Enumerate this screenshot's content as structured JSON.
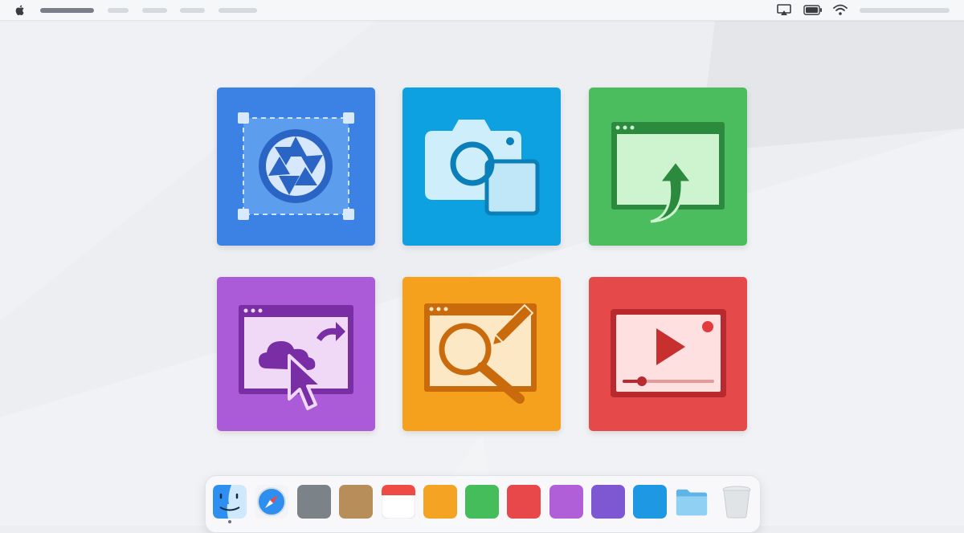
{
  "menubar": {
    "apple_icon": "apple-icon",
    "status_icons": [
      "airplay-icon",
      "battery-icon",
      "wifi-icon"
    ]
  },
  "tiles": [
    {
      "name": "screenshot-capture-tile",
      "icon": "aperture-selection-icon",
      "color": "#3b82e4"
    },
    {
      "name": "camera-overlay-tile",
      "icon": "camera-icon",
      "color": "#0ea1e2"
    },
    {
      "name": "window-upload-tile",
      "icon": "window-arrow-up-icon",
      "color": "#4cbd5e"
    },
    {
      "name": "cloud-cursor-tile",
      "icon": "cloud-cursor-icon",
      "color": "#ab5ad8"
    },
    {
      "name": "search-annotate-tile",
      "icon": "search-pencil-icon",
      "color": "#f5a11e"
    },
    {
      "name": "video-record-tile",
      "icon": "video-play-icon",
      "color": "#e6494a"
    }
  ],
  "dock": {
    "items": [
      {
        "name": "finder-icon",
        "color": "#3d9cf0"
      },
      {
        "name": "safari-icon",
        "color": "#2f8ff0"
      },
      {
        "name": "gray-app-icon",
        "color": "#7c8388"
      },
      {
        "name": "brown-app-icon",
        "color": "#b78e5a"
      },
      {
        "name": "calendar-icon",
        "color": "#ef4b45"
      },
      {
        "name": "orange-app-icon",
        "color": "#f5a323"
      },
      {
        "name": "green-app-icon",
        "color": "#45bd5b"
      },
      {
        "name": "red-app-icon",
        "color": "#e8484a"
      },
      {
        "name": "purple-app-icon",
        "color": "#b15fd8"
      },
      {
        "name": "violet-app-icon",
        "color": "#7e57d2"
      },
      {
        "name": "blue-app-icon",
        "color": "#1f98e4"
      },
      {
        "name": "folder-icon",
        "color": "#7cc6ef"
      },
      {
        "name": "trash-icon",
        "color": "#d7dadd"
      }
    ]
  }
}
